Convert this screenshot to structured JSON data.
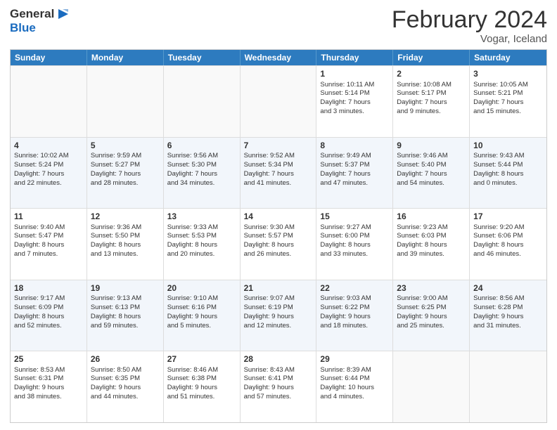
{
  "logo": {
    "line1": "General",
    "line2": "Blue"
  },
  "title": "February 2024",
  "subtitle": "Vogar, Iceland",
  "days_of_week": [
    "Sunday",
    "Monday",
    "Tuesday",
    "Wednesday",
    "Thursday",
    "Friday",
    "Saturday"
  ],
  "rows": [
    [
      {
        "day": "",
        "info": ""
      },
      {
        "day": "",
        "info": ""
      },
      {
        "day": "",
        "info": ""
      },
      {
        "day": "",
        "info": ""
      },
      {
        "day": "1",
        "info": "Sunrise: 10:11 AM\nSunset: 5:14 PM\nDaylight: 7 hours\nand 3 minutes."
      },
      {
        "day": "2",
        "info": "Sunrise: 10:08 AM\nSunset: 5:17 PM\nDaylight: 7 hours\nand 9 minutes."
      },
      {
        "day": "3",
        "info": "Sunrise: 10:05 AM\nSunset: 5:21 PM\nDaylight: 7 hours\nand 15 minutes."
      }
    ],
    [
      {
        "day": "4",
        "info": "Sunrise: 10:02 AM\nSunset: 5:24 PM\nDaylight: 7 hours\nand 22 minutes."
      },
      {
        "day": "5",
        "info": "Sunrise: 9:59 AM\nSunset: 5:27 PM\nDaylight: 7 hours\nand 28 minutes."
      },
      {
        "day": "6",
        "info": "Sunrise: 9:56 AM\nSunset: 5:30 PM\nDaylight: 7 hours\nand 34 minutes."
      },
      {
        "day": "7",
        "info": "Sunrise: 9:52 AM\nSunset: 5:34 PM\nDaylight: 7 hours\nand 41 minutes."
      },
      {
        "day": "8",
        "info": "Sunrise: 9:49 AM\nSunset: 5:37 PM\nDaylight: 7 hours\nand 47 minutes."
      },
      {
        "day": "9",
        "info": "Sunrise: 9:46 AM\nSunset: 5:40 PM\nDaylight: 7 hours\nand 54 minutes."
      },
      {
        "day": "10",
        "info": "Sunrise: 9:43 AM\nSunset: 5:44 PM\nDaylight: 8 hours\nand 0 minutes."
      }
    ],
    [
      {
        "day": "11",
        "info": "Sunrise: 9:40 AM\nSunset: 5:47 PM\nDaylight: 8 hours\nand 7 minutes."
      },
      {
        "day": "12",
        "info": "Sunrise: 9:36 AM\nSunset: 5:50 PM\nDaylight: 8 hours\nand 13 minutes."
      },
      {
        "day": "13",
        "info": "Sunrise: 9:33 AM\nSunset: 5:53 PM\nDaylight: 8 hours\nand 20 minutes."
      },
      {
        "day": "14",
        "info": "Sunrise: 9:30 AM\nSunset: 5:57 PM\nDaylight: 8 hours\nand 26 minutes."
      },
      {
        "day": "15",
        "info": "Sunrise: 9:27 AM\nSunset: 6:00 PM\nDaylight: 8 hours\nand 33 minutes."
      },
      {
        "day": "16",
        "info": "Sunrise: 9:23 AM\nSunset: 6:03 PM\nDaylight: 8 hours\nand 39 minutes."
      },
      {
        "day": "17",
        "info": "Sunrise: 9:20 AM\nSunset: 6:06 PM\nDaylight: 8 hours\nand 46 minutes."
      }
    ],
    [
      {
        "day": "18",
        "info": "Sunrise: 9:17 AM\nSunset: 6:09 PM\nDaylight: 8 hours\nand 52 minutes."
      },
      {
        "day": "19",
        "info": "Sunrise: 9:13 AM\nSunset: 6:13 PM\nDaylight: 8 hours\nand 59 minutes."
      },
      {
        "day": "20",
        "info": "Sunrise: 9:10 AM\nSunset: 6:16 PM\nDaylight: 9 hours\nand 5 minutes."
      },
      {
        "day": "21",
        "info": "Sunrise: 9:07 AM\nSunset: 6:19 PM\nDaylight: 9 hours\nand 12 minutes."
      },
      {
        "day": "22",
        "info": "Sunrise: 9:03 AM\nSunset: 6:22 PM\nDaylight: 9 hours\nand 18 minutes."
      },
      {
        "day": "23",
        "info": "Sunrise: 9:00 AM\nSunset: 6:25 PM\nDaylight: 9 hours\nand 25 minutes."
      },
      {
        "day": "24",
        "info": "Sunrise: 8:56 AM\nSunset: 6:28 PM\nDaylight: 9 hours\nand 31 minutes."
      }
    ],
    [
      {
        "day": "25",
        "info": "Sunrise: 8:53 AM\nSunset: 6:31 PM\nDaylight: 9 hours\nand 38 minutes."
      },
      {
        "day": "26",
        "info": "Sunrise: 8:50 AM\nSunset: 6:35 PM\nDaylight: 9 hours\nand 44 minutes."
      },
      {
        "day": "27",
        "info": "Sunrise: 8:46 AM\nSunset: 6:38 PM\nDaylight: 9 hours\nand 51 minutes."
      },
      {
        "day": "28",
        "info": "Sunrise: 8:43 AM\nSunset: 6:41 PM\nDaylight: 9 hours\nand 57 minutes."
      },
      {
        "day": "29",
        "info": "Sunrise: 8:39 AM\nSunset: 6:44 PM\nDaylight: 10 hours\nand 4 minutes."
      },
      {
        "day": "",
        "info": ""
      },
      {
        "day": "",
        "info": ""
      }
    ]
  ]
}
